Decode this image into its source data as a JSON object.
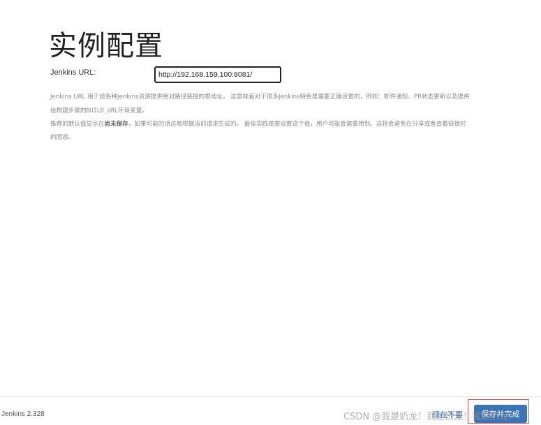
{
  "page": {
    "title": "实例配置"
  },
  "form": {
    "url_label": "Jenkins URL:",
    "url_value": "http://192.168.159.100:8081/"
  },
  "help": {
    "line1_text": "Jenkins URL 用于给各种Jenkins资源提供绝对路径链接的根地址。 这意味着对于很多Jenkins特色是需要正确设置的，例如：邮件通知、PR状态更新以及提供给构建步骤的",
    "line1_code": "BUILD_URL",
    "line1_tail": "环境变量。",
    "line2_prefix": "推荐的默认值显示在",
    "line2_bold": "尚未保存",
    "line2_tail": "，如果可能的话这是根据当前请求生成的。 最佳实践是要设置这个值，用户可能会需要用到。这将会避免在分享或者查看链接时的困惑。"
  },
  "footer": {
    "version": "Jenkins 2.328",
    "skip_label": "现在不要",
    "save_label": "保存并完成",
    "watermark": "CSDN @我是奶龙！我是奶龙！我是奶龙！"
  }
}
